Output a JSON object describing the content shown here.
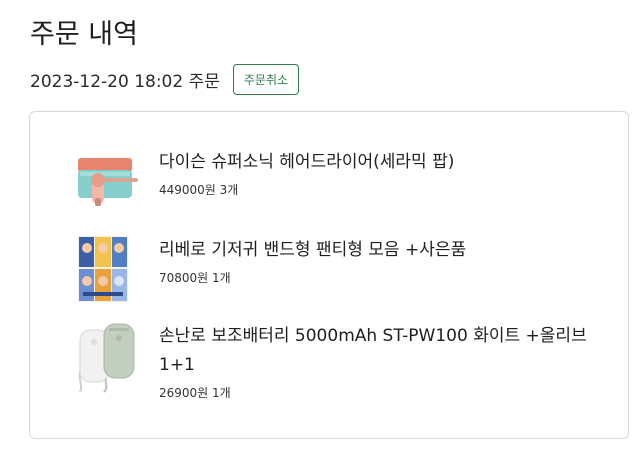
{
  "page": {
    "title": "주문 내역"
  },
  "order": {
    "datetime_label": "2023-12-20 18:02 주문",
    "cancel_label": "주문취소"
  },
  "items": [
    {
      "name": "다이슨 슈퍼소닉 헤어드라이어(세라믹 팝)",
      "meta": "449000원 3개",
      "icon": "hair-dryer-image"
    },
    {
      "name": "리베로 기저귀 밴드형 팬티형 모음 +사은품",
      "meta": "70800원 1개",
      "icon": "diaper-pack-image"
    },
    {
      "name": "손난로 보조배터리 5000mAh ST-PW100 화이트 +올리브 1+1",
      "meta": "26900원 1개",
      "icon": "hand-warmer-power-bank-image"
    }
  ],
  "colors": {
    "accent": "#2e7d4f",
    "border": "#d8d8d8"
  }
}
